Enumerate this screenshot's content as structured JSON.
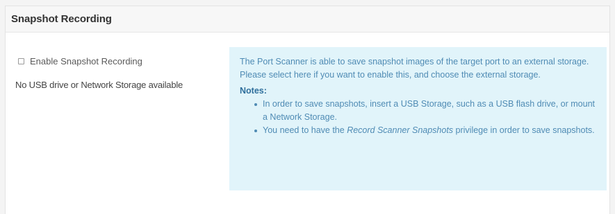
{
  "panel": {
    "title": "Snapshot Recording"
  },
  "left": {
    "checkbox_label": "Enable Snapshot Recording",
    "checkbox_checked": false,
    "storage_message": "No USB drive or Network Storage available"
  },
  "info": {
    "description": "The Port Scanner is able to save snapshot images of the target port to an external storage. Please select here if you want to enable this, and choose the external storage.",
    "notes_title": "Notes:",
    "note1": "In order to save snapshots, insert a USB Storage, such as a USB flash drive, or mount a Network Storage.",
    "note2_before": "You need to have the ",
    "note2_emphasis": "Record Scanner Snapshots",
    "note2_after": " privilege in order to save snapshots."
  },
  "colors": {
    "info_background": "#e1f4fa",
    "info_text": "#4f8bb4",
    "notes_title": "#2f6f9c"
  }
}
